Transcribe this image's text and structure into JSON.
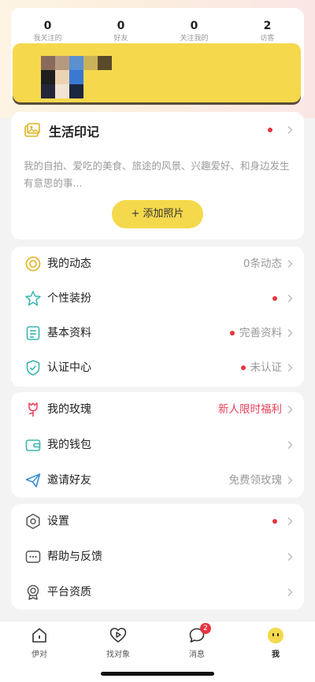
{
  "stats": [
    {
      "num": "0",
      "label": "我关注的"
    },
    {
      "num": "0",
      "label": "好友"
    },
    {
      "num": "0",
      "label": "关注我的"
    },
    {
      "num": "2",
      "label": "访客"
    }
  ],
  "life_card": {
    "title": "生活印记",
    "desc": "我的自拍、爱吃的美食、旅途的风景、兴趣爱好、和身边发生有意思的事...",
    "add_button": "+ 添加照片"
  },
  "group1": [
    {
      "label": "我的动态",
      "value": "0条动态",
      "dot": false,
      "icon": "compass-icon"
    },
    {
      "label": "个性装扮",
      "value": "",
      "dot": true,
      "icon": "star-icon"
    },
    {
      "label": "基本资料",
      "value": "完善资料",
      "dot": true,
      "icon": "profile-doc-icon"
    },
    {
      "label": "认证中心",
      "value": "未认证",
      "dot": true,
      "icon": "shield-check-icon"
    }
  ],
  "group2": [
    {
      "label": "我的玫瑰",
      "value": "新人限时福利",
      "icon": "rose-icon"
    },
    {
      "label": "我的钱包",
      "value": "",
      "icon": "wallet-icon"
    },
    {
      "label": "邀请好友",
      "value": "免费领玫瑰",
      "icon": "paper-plane-icon"
    }
  ],
  "group3": [
    {
      "label": "设置",
      "value": "",
      "dot": true,
      "icon": "settings-icon"
    },
    {
      "label": "帮助与反馈",
      "value": "",
      "dot": false,
      "icon": "feedback-icon"
    },
    {
      "label": "平台资质",
      "value": "",
      "dot": false,
      "icon": "certificate-icon"
    }
  ],
  "tabs": [
    {
      "label": "伊对",
      "icon": "home-icon"
    },
    {
      "label": "找对象",
      "icon": "heart-play-icon"
    },
    {
      "label": "消息",
      "icon": "chat-icon",
      "badge": "2"
    },
    {
      "label": "我",
      "icon": "face-icon"
    }
  ],
  "colors": {
    "accent_yellow": "#f5d94c",
    "red_dot": "#e6363f",
    "highlight_red": "#e8425a"
  }
}
